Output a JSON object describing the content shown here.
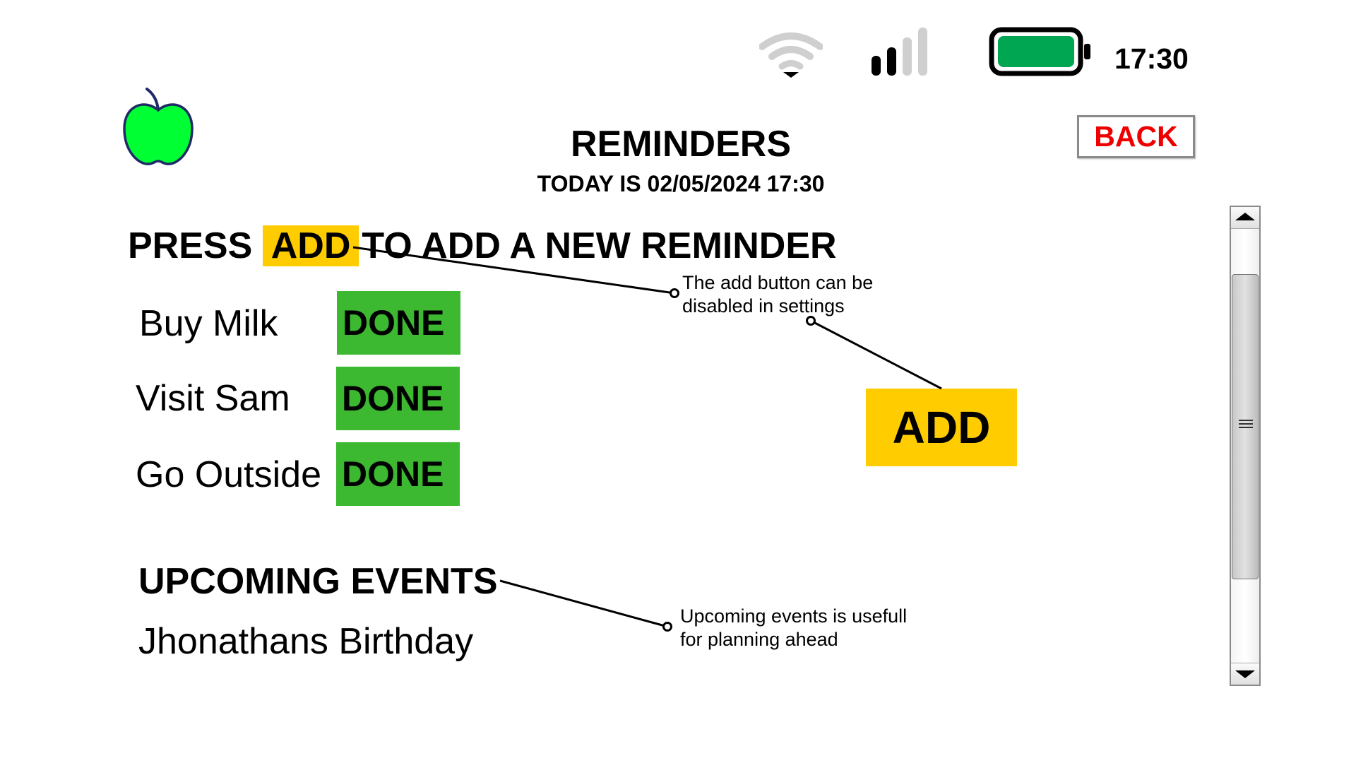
{
  "status_bar": {
    "time": "17:30",
    "icons": [
      "wifi-icon",
      "signal-icon",
      "battery-icon"
    ],
    "battery_color": "#00a651"
  },
  "app": {
    "logo_icon": "apple-icon",
    "logo_color": "#00ff33"
  },
  "header": {
    "title": "REMINDERS",
    "subtitle": "TODAY IS 02/05/2024 17:30",
    "back_label": "BACK",
    "back_color": "#ee0000"
  },
  "instruction": {
    "prefix": "PRESS",
    "highlight": "ADD",
    "suffix": "TO ADD A NEW REMINDER"
  },
  "reminders": [
    {
      "label": "Buy Milk",
      "button": "DONE"
    },
    {
      "label": "Visit Sam",
      "button": "DONE"
    },
    {
      "label": "Go Outside",
      "button": "DONE"
    }
  ],
  "add_button": {
    "label": "ADD",
    "color": "#ffcc00"
  },
  "done_color": "#3cb831",
  "upcoming": {
    "title": "UPCOMING EVENTS",
    "events": [
      "Jhonathans Birthday"
    ]
  },
  "annotations": [
    {
      "line1": "The add button can be",
      "line2": "disabled in settings"
    },
    {
      "line1": "Upcoming events is usefull",
      "line2": "for planning ahead"
    }
  ]
}
